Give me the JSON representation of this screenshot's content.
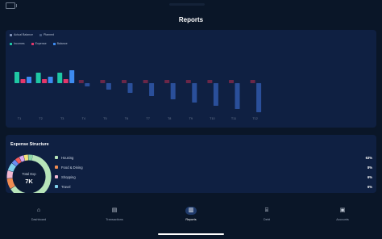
{
  "page": {
    "title": "Reports"
  },
  "chart": {
    "legend_top": [
      {
        "label": "Actual Balance",
        "color": "#7d90b5"
      },
      {
        "label": "Planned",
        "color": "#42557a"
      }
    ],
    "legend_series": [
      {
        "label": "Incomes",
        "color": "#1fc7a4"
      },
      {
        "label": "Expense",
        "color": "#e3376b"
      },
      {
        "label": "Balance",
        "color": "#3d8bf0"
      }
    ]
  },
  "chart_data": {
    "type": "bar",
    "categories": [
      "T1",
      "T2",
      "T3",
      "T4",
      "T5",
      "T6",
      "T7",
      "T8",
      "T9",
      "T10",
      "T11",
      "T12"
    ],
    "series": [
      {
        "name": "Incomes",
        "values": [
          14,
          13,
          13,
          0,
          0,
          0,
          0,
          0,
          0,
          0,
          0,
          0
        ],
        "color": "#1fc7a4"
      },
      {
        "name": "Expense",
        "values": [
          5,
          5,
          5,
          4,
          4,
          4,
          4,
          4,
          4,
          4,
          4,
          4
        ],
        "color": "#e3376b"
      },
      {
        "name": "Balance",
        "values": [
          8,
          8,
          16,
          -4,
          -8,
          -12,
          -16,
          -20,
          -24,
          -28,
          -32,
          -36
        ],
        "color": "#3d8bf0"
      }
    ]
  },
  "expense": {
    "title": "Expense Structure",
    "total_label": "Total Exp",
    "total_value": "7K",
    "items": [
      {
        "name": "Housing",
        "percent": "63%",
        "color": "#b7e4b9"
      },
      {
        "name": "Food & Dining",
        "percent": "8%",
        "color": "#f08c52"
      },
      {
        "name": "Shopping",
        "percent": "6%",
        "color": "#f3b8d2"
      },
      {
        "name": "Travel",
        "percent": "6%",
        "color": "#7fd0ea"
      }
    ],
    "donut_other_colors": [
      "#6b8cf0",
      "#f25b5b",
      "#d8a7f0",
      "#f5e27a",
      "#8fd6a8"
    ]
  },
  "nav": {
    "items": [
      {
        "label": "Dashboard",
        "icon": "home-icon",
        "glyph": "⌂"
      },
      {
        "label": "Transactions",
        "icon": "receipt-icon",
        "glyph": "▤"
      },
      {
        "label": "Reports",
        "icon": "bar-chart-icon",
        "glyph": "▥"
      },
      {
        "label": "Debt",
        "icon": "bank-icon",
        "glyph": "⌸"
      },
      {
        "label": "Accounts",
        "icon": "wallet-icon",
        "glyph": "▣"
      }
    ]
  }
}
